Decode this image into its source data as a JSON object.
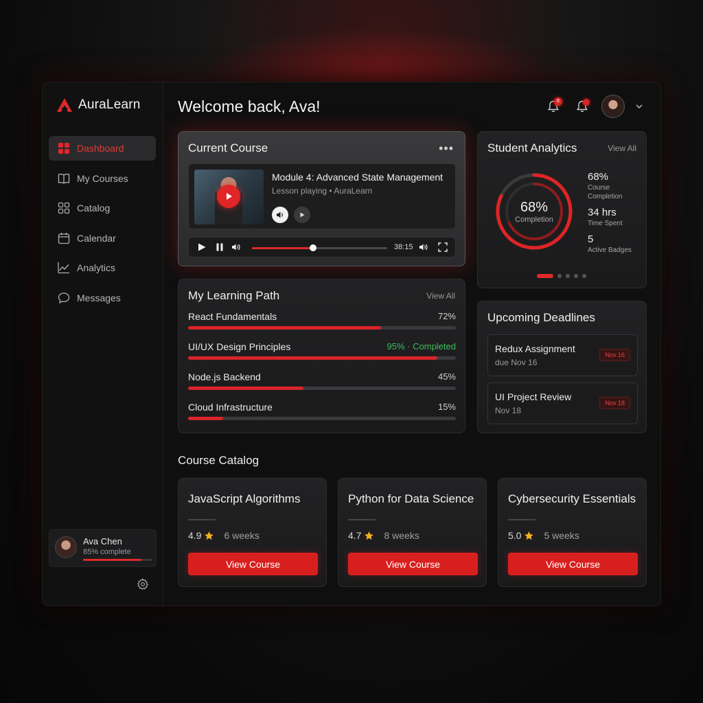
{
  "brand": {
    "name": "AuraLearn",
    "accent": "#e02a2a"
  },
  "sidebar": {
    "items": [
      {
        "label": "Dashboard",
        "icon": "dashboard-icon",
        "active": true
      },
      {
        "label": "My Courses",
        "icon": "book-icon",
        "active": false
      },
      {
        "label": "Catalog",
        "icon": "catalog-icon",
        "active": false
      },
      {
        "label": "Calendar",
        "icon": "calendar-icon",
        "active": false
      },
      {
        "label": "Analytics",
        "icon": "analytics-icon",
        "active": false
      },
      {
        "label": "Messages",
        "icon": "message-icon",
        "active": false
      }
    ],
    "profile": {
      "name": "Ava Chen",
      "progress_text": "85% complete",
      "progress": 0.85
    }
  },
  "header": {
    "welcome": "Welcome back, Ava!",
    "notifications_badge": "8"
  },
  "current_course": {
    "title": "Current Course",
    "lesson_title": "Module 4: Advanced State Management",
    "lesson_sub": "Lesson playing  •  AuraLearn",
    "time": "38:15",
    "seek_progress": 0.45
  },
  "analytics": {
    "title": "Student Analytics",
    "view_all": "View All",
    "ring_value": "68%",
    "ring_label": "Completion",
    "completion_fraction": 0.68,
    "stats": [
      {
        "value": "68%",
        "label": "Course Completion"
      },
      {
        "value": "34 hrs",
        "label": "Time Spent"
      },
      {
        "value": "5",
        "label": "Active Badges"
      }
    ]
  },
  "learning_path": {
    "title": "My Learning Path",
    "view_all": "View All",
    "items": [
      {
        "name": "React Fundamentals",
        "pct": "72%",
        "value": 0.72
      },
      {
        "name": "UI/UX Design Principles",
        "pct": "95% · Completed",
        "value": 0.93
      },
      {
        "name": "Node.js Backend",
        "pct": "45%",
        "value": 0.43
      },
      {
        "name": "Cloud Infrastructure",
        "pct": "15%",
        "value": 0.13
      }
    ]
  },
  "deadlines": {
    "title": "Upcoming Deadlines",
    "items": [
      {
        "title": "Redux Assignment",
        "sub": "due Nov 16",
        "tag": "Nov 16"
      },
      {
        "title": "UI Project Review",
        "sub": "Nov 18",
        "tag": "Nov 18"
      }
    ]
  },
  "catalog": {
    "title": "Course Catalog",
    "courses": [
      {
        "title": "JavaScript Algorithms",
        "rating": "4.9",
        "duration": "6 weeks",
        "button": "View Course"
      },
      {
        "title": "Python for Data Science",
        "rating": "4.7",
        "duration": "8 weeks",
        "button": "View Course"
      },
      {
        "title": "Cybersecurity Essentials",
        "rating": "5.0",
        "duration": "5 weeks",
        "button": "View Course"
      }
    ]
  }
}
